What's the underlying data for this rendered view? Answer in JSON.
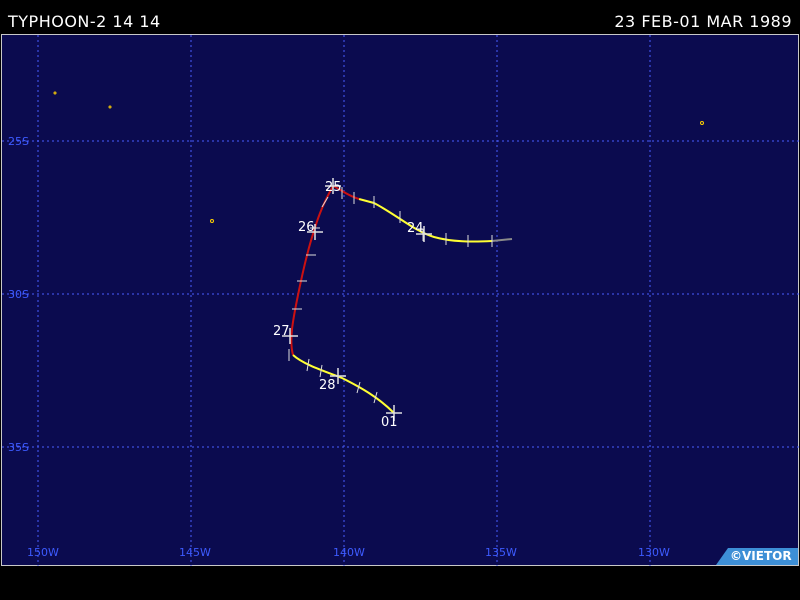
{
  "header": {
    "left": "TYPHOON-2 14 14",
    "right": "23 FEB-01 MAR 1989"
  },
  "credit": "©VIETOR",
  "colors": {
    "ocean": "#0b0b4f",
    "grid": "#4a5cff",
    "axis_label": "#3d5bff",
    "track_tropical_storm": "#ffff33",
    "track_typhoon": "#cc1111",
    "track_extratropical": "#8a8a8a",
    "island": "#ffd000"
  },
  "map": {
    "lon_labels": [
      "150W",
      "145W",
      "140W",
      "135W",
      "130W"
    ],
    "lat_labels": [
      "25S",
      "30S",
      "35S"
    ]
  },
  "track": {
    "day_labels": [
      {
        "text": "24",
        "lon": -137.6,
        "lat": -27.8
      },
      {
        "text": "25",
        "lon": -140.6,
        "lat": -26.6
      },
      {
        "text": "26",
        "lon": -141.3,
        "lat": -27.8
      },
      {
        "text": "27",
        "lon": -141.8,
        "lat": -31.2
      },
      {
        "text": "28",
        "lon": -140.4,
        "lat": -32.8
      },
      {
        "text": "01",
        "lon": -138.2,
        "lat": -34.0
      }
    ]
  }
}
